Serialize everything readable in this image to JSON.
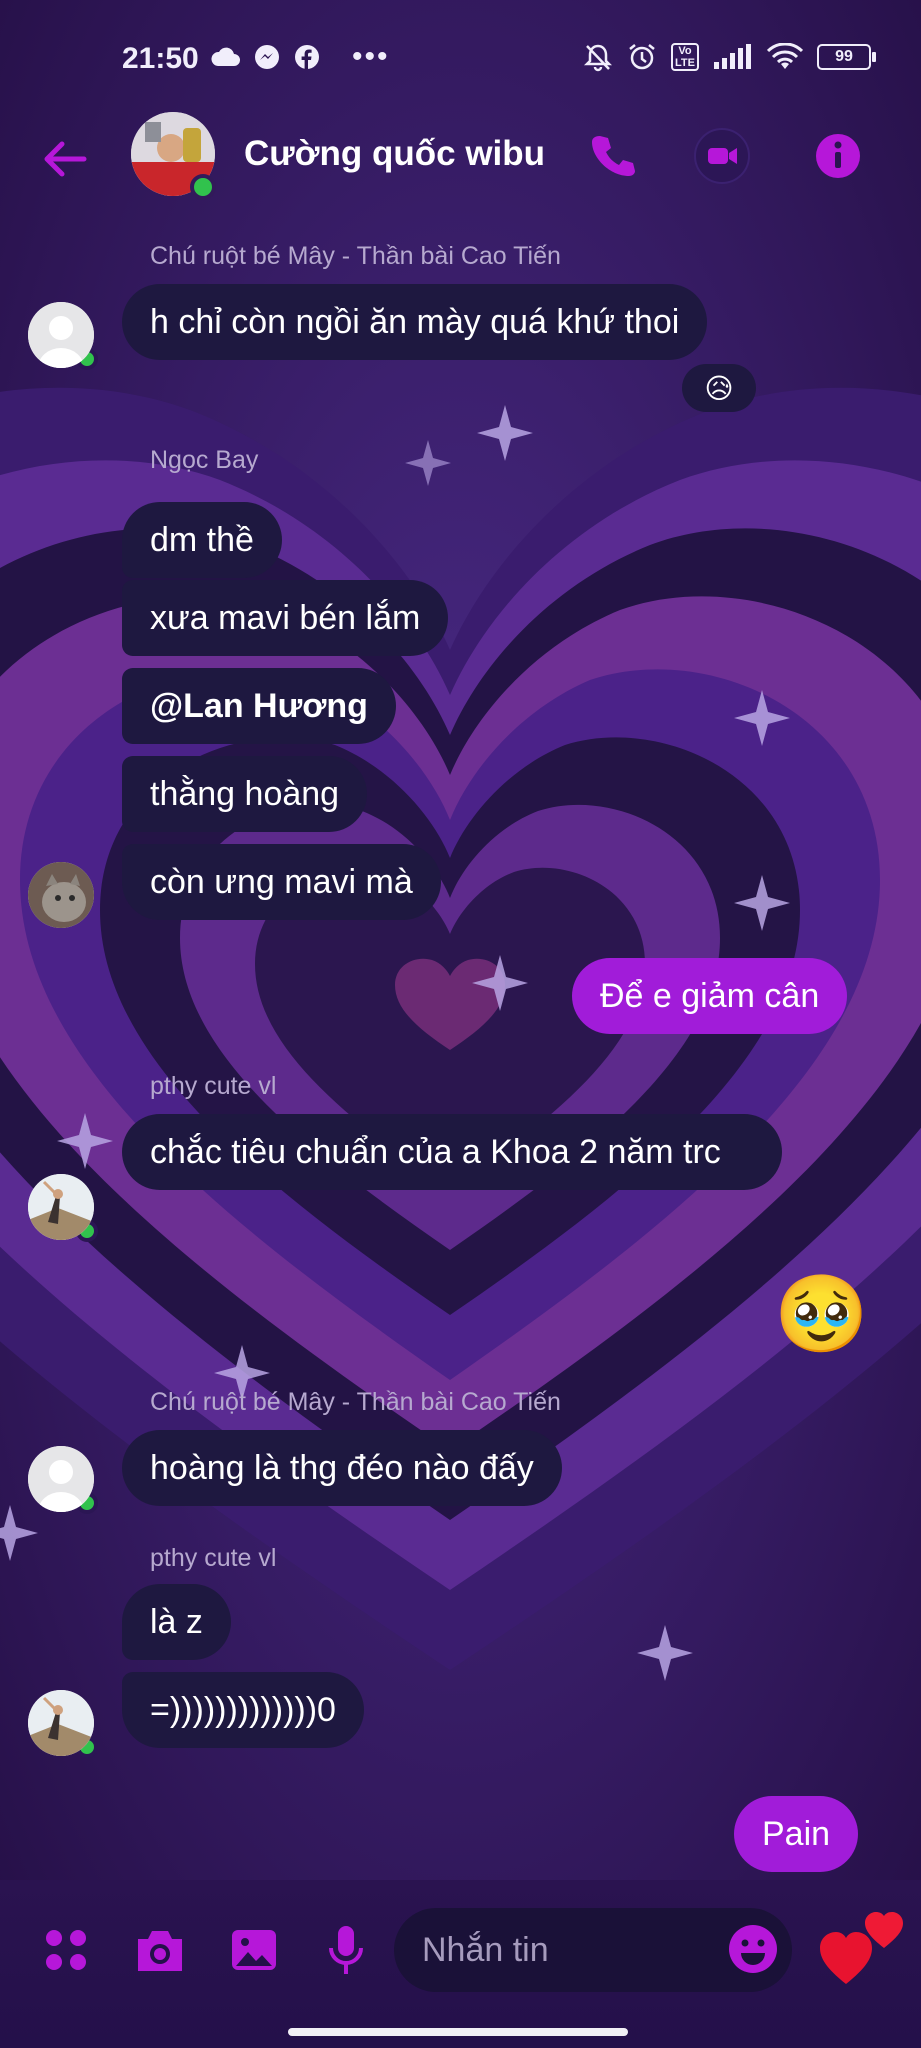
{
  "status_bar": {
    "time": "21:50",
    "volte_label": "Vo\nLTE",
    "battery": "99"
  },
  "header": {
    "title": "Cường quốc wibu",
    "accent_color": "#b617d9"
  },
  "messages": [
    {
      "sender": "Chú ruột bé Mây - Thần bài Cao Tiến",
      "texts": [
        "h chỉ còn ngồi ăn mày quá khứ thoi"
      ],
      "reaction": "😥"
    },
    {
      "sender": "Ngọc Bay",
      "texts": [
        "dm thề",
        "xưa mavi bén lắm",
        "@Lan Hương",
        "thằng hoàng",
        "còn ưng mavi mà"
      ]
    },
    {
      "outgoing": true,
      "texts": [
        "Để e giảm cân"
      ]
    },
    {
      "sender": "pthy cute vl",
      "texts": [
        "chắc tiêu chuẩn của a Khoa 2 năm trc"
      ]
    },
    {
      "outgoing": true,
      "emoji": "🥹"
    },
    {
      "sender": "Chú ruột bé Mây - Thần bài Cao Tiến",
      "texts": [
        "hoàng là thg đéo nào đấy"
      ]
    },
    {
      "sender": "pthy cute vl",
      "texts": [
        "là z",
        "=)))))))))))))0"
      ]
    },
    {
      "outgoing": true,
      "texts": [
        "Pain"
      ]
    }
  ],
  "composer": {
    "placeholder": "Nhắn tin"
  }
}
